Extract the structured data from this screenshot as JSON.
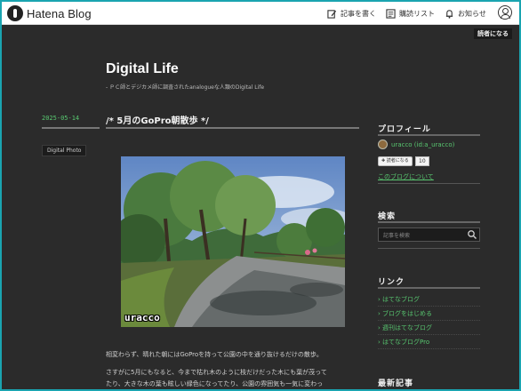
{
  "hatena_bar": {
    "logo_text": "Hatena Blog",
    "write_label": "記事を書く",
    "reading_list_label": "購読リスト",
    "notifications_label": "お知らせ",
    "icons": {
      "write": "pencil-icon",
      "reading_list": "bookmark-list-icon",
      "notifications": "bell-icon",
      "user": "user-icon"
    }
  },
  "reader_mode_button": "読者になる",
  "blog": {
    "title": "Digital Life",
    "description": "- ＰＣ師とデジカメ師に調査されたanalogueな人類のDigital Life"
  },
  "entry": {
    "date": "2025-05-14",
    "title": "/*  5月のGoPro朝散歩  */",
    "category": "Digital Photo",
    "photo_watermark": "uracco",
    "paragraphs": [
      "相変わらず、晴れた朝にはGoProを持って公園の中を通り抜けるだけの散歩。",
      "さすがに5月にもなると、今まで枯れ木のように枝だけだった木にも葉が茂って",
      "たり、大きな木の葉も眩しい緑色になってたり、公園の雰囲気も一気に変わっ"
    ]
  },
  "sidebar": {
    "profile": {
      "heading": "プロフィール",
      "user": "uracco (id:a_uracco)",
      "subscribe_label": "読者になる",
      "subscriber_count": "10",
      "about_link": "このブログについて"
    },
    "search": {
      "heading": "検索",
      "placeholder": "記事を検索",
      "icon": "search-icon"
    },
    "links": {
      "heading": "リンク",
      "items": [
        "はてなブログ",
        "ブログをはじめる",
        "週刊はてなブログ",
        "はてなブログPro"
      ]
    },
    "recent": {
      "heading": "最新記事"
    }
  },
  "colors": {
    "background": "#2b2b2b",
    "accent_green": "#58c770",
    "frame_teal": "#1aa4b0"
  }
}
